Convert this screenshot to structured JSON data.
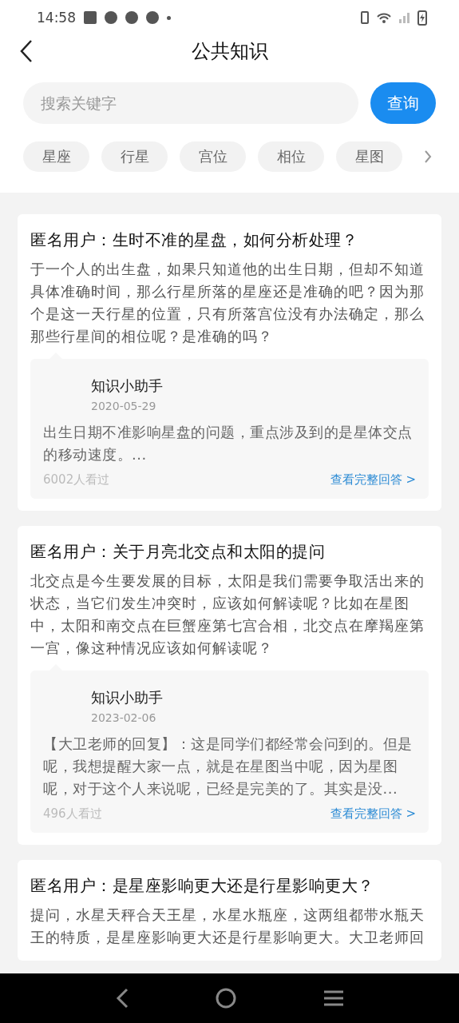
{
  "status_bar": {
    "time": "14:58"
  },
  "header": {
    "title": "公共知识"
  },
  "search": {
    "placeholder": "搜索关键字",
    "button": "查询"
  },
  "categories": [
    {
      "label": "星座"
    },
    {
      "label": "行星"
    },
    {
      "label": "宫位"
    },
    {
      "label": "相位"
    },
    {
      "label": "星图"
    }
  ],
  "questions": [
    {
      "title": "匿名用户：生时不准的星盘，如何分析处理？",
      "body": "于一个人的出生盘，如果只知道他的出生日期，但却不知道具体准确时间，那么行星所落的星座还是准确的吧？因为那个是这一天行星的位置，只有所落宫位没有办法确定，那么那些行星间的相位呢？是准确的吗？",
      "answer": {
        "author": "知识小助手",
        "date": "2020-05-29",
        "text": "出生日期不准影响星盘的问题，重点涉及到的是星体交点的移动速度。...",
        "views": "6002人看过",
        "link": "查看完整回答 >"
      }
    },
    {
      "title": "匿名用户：关于月亮北交点和太阳的提问",
      "body": "北交点是今生要发展的目标，太阳是我们需要争取活出来的状态，当它们发生冲突时，应该如何解读呢？比如在星图中，太阳和南交点在巨蟹座第七宫合相，北交点在摩羯座第一宫，像这种情况应该如何解读呢？",
      "answer": {
        "author": "知识小助手",
        "date": "2023-02-06",
        "text": "【大卫老师的回复】：这是同学们都经常会问到的。但是呢，我想提醒大家一点，就是在星图当中呢，因为星图呢，对于这个人来说呢，已经是完美的了。其实是没...",
        "views": "496人看过",
        "link": "查看完整回答 >"
      }
    },
    {
      "title": "匿名用户：是星座影响更大还是行星影响更大？",
      "body": "提问，水星天秤合天王星，水星水瓶座，这两组都带水瓶天王的特质，是星座影响更大还是行星影响更大。大卫老师回"
    }
  ]
}
